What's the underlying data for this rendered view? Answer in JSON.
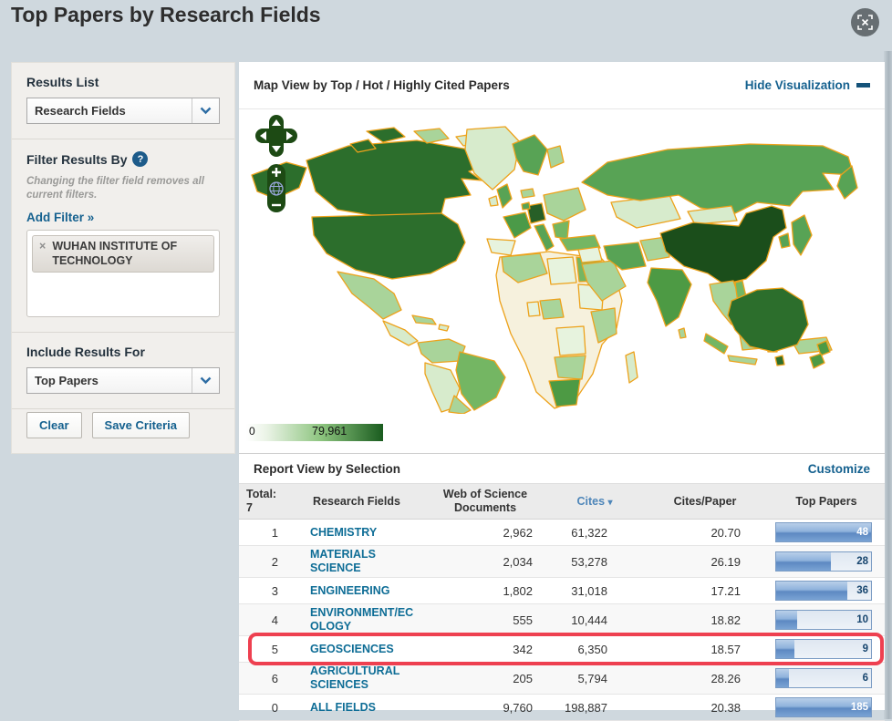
{
  "page": {
    "title": "Top Papers by Research Fields"
  },
  "sidebar": {
    "results_list": {
      "heading": "Results List",
      "dropdown_value": "Research Fields"
    },
    "filter": {
      "heading": "Filter Results By",
      "help_glyph": "?",
      "note": "Changing the filter field removes all current filters.",
      "add_filter_label": "Add Filter »",
      "tag": {
        "remove_glyph": "×",
        "label": "WUHAN INSTITUTE OF TECHNOLOGY"
      }
    },
    "include_results": {
      "heading": "Include Results For",
      "dropdown_value": "Top Papers"
    },
    "actions": {
      "clear_label": "Clear",
      "save_label": "Save Criteria"
    }
  },
  "visualization": {
    "title": "Map View by Top / Hot / Highly Cited Papers",
    "hide_label": "Hide Visualization",
    "legend": {
      "min": "0",
      "max": "79,961"
    }
  },
  "report": {
    "title": "Report View by Selection",
    "customize_label": "Customize",
    "table": {
      "total_label": "Total:",
      "total_count": "7",
      "columns": [
        "Research Fields",
        "Web of Science Documents",
        "Cites",
        "Cites/Paper",
        "Top Papers"
      ],
      "sorted_column": "Cites",
      "sort_glyph": "▾",
      "rows": [
        {
          "rank": "1",
          "field": "CHEMISTRY",
          "documents": "2,962",
          "cites": "61,322",
          "cites_per_paper": "20.70",
          "top_papers": "48",
          "bar_pct": 100,
          "highlighted": false
        },
        {
          "rank": "2",
          "field": "MATERIALS SCIENCE",
          "documents": "2,034",
          "cites": "53,278",
          "cites_per_paper": "26.19",
          "top_papers": "28",
          "bar_pct": 58,
          "highlighted": false
        },
        {
          "rank": "3",
          "field": "ENGINEERING",
          "documents": "1,802",
          "cites": "31,018",
          "cites_per_paper": "17.21",
          "top_papers": "36",
          "bar_pct": 75,
          "highlighted": false
        },
        {
          "rank": "4",
          "field": "ENVIRONMENT/ECOLOGY",
          "documents": "555",
          "cites": "10,444",
          "cites_per_paper": "18.82",
          "top_papers": "10",
          "bar_pct": 22,
          "highlighted": false
        },
        {
          "rank": "5",
          "field": "GEOSCIENCES",
          "documents": "342",
          "cites": "6,350",
          "cites_per_paper": "18.57",
          "top_papers": "9",
          "bar_pct": 19,
          "highlighted": true
        },
        {
          "rank": "6",
          "field": "AGRICULTURAL SCIENCES",
          "documents": "205",
          "cites": "5,794",
          "cites_per_paper": "28.26",
          "top_papers": "6",
          "bar_pct": 13,
          "highlighted": false
        },
        {
          "rank": "0",
          "field": "ALL FIELDS",
          "documents": "9,760",
          "cites": "198,887",
          "cites_per_paper": "20.38",
          "top_papers": "185",
          "bar_pct": 100,
          "highlighted": false
        }
      ]
    }
  },
  "colors": {
    "highlight_frame": "#ee4050",
    "bar_fill": "#6f9bd0",
    "link_blue": "#15618f",
    "map_border": "#eda21b",
    "map_green_max": "#1a5c1f"
  }
}
